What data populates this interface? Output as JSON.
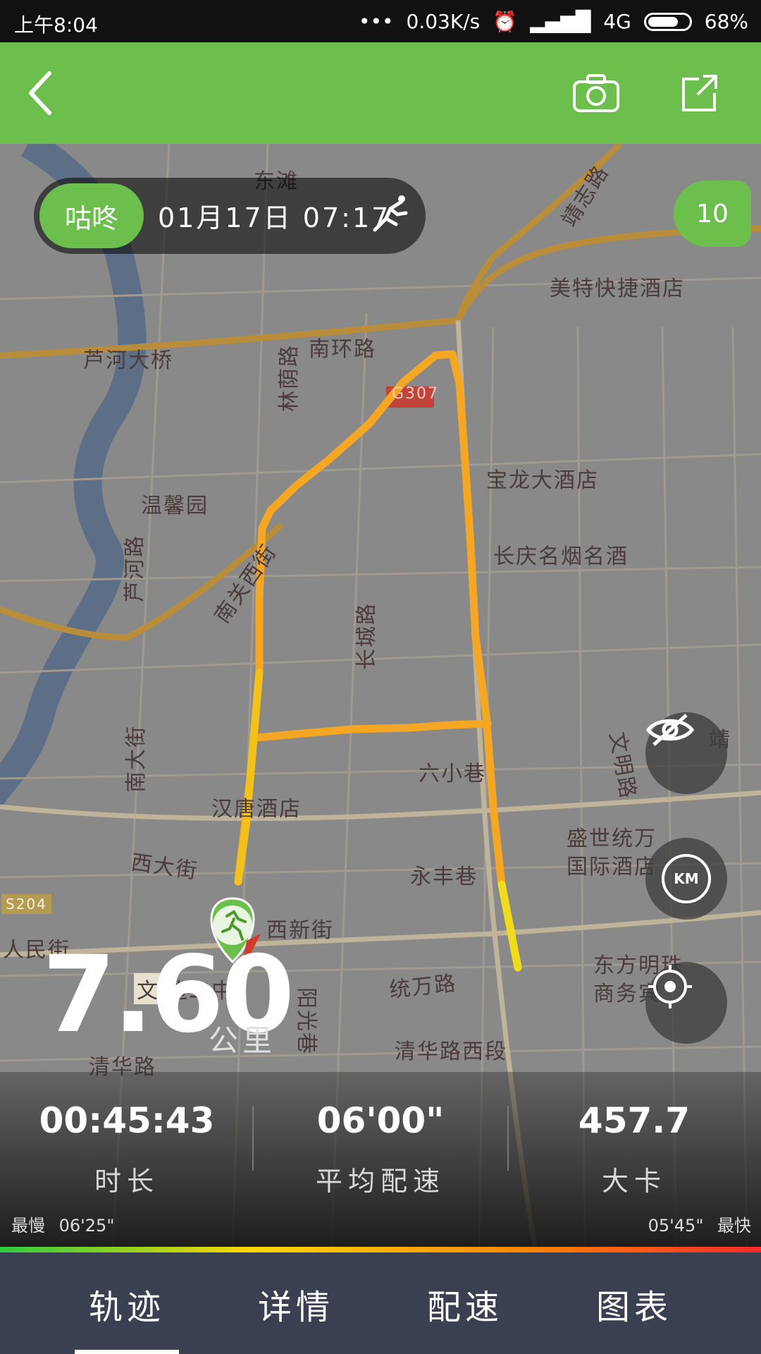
{
  "status_bar": {
    "time": "上午8:04",
    "net_speed": "0.03K/s",
    "signal": "4G",
    "battery": "68%"
  },
  "map": {
    "labels": {
      "l1": "东滩",
      "l2": "靖志路",
      "l3": "美特快捷酒店",
      "l4": "芦河大桥",
      "l5": "南环路",
      "l6": "G307",
      "l7": "林荫路",
      "l8": "宝龙大酒店",
      "l9": "温馨园",
      "l10": "长庆名烟名酒",
      "l11": "芦河路",
      "l12": "南关西街",
      "l13": "长城路",
      "l14": "南大街",
      "l15": "六小巷",
      "l16": "汉唐酒店",
      "l17": "文明路",
      "l18": "盛世统万",
      "l19": "国际酒店",
      "l20": "西大街",
      "l21": "永丰巷",
      "l22": "西新街",
      "l23": "S204",
      "l24": "人民街",
      "l25": "东方明珠",
      "l26": "商务宾",
      "l27": "统万路",
      "l28": "边二中",
      "l29": "阳光巷",
      "l30": "清华路西段",
      "l31": "清华路",
      "l32": "文",
      "l33": "靖"
    }
  },
  "session": {
    "brand": "咕咚",
    "datetime": "01月17日 07:17",
    "badge": "10"
  },
  "distance": {
    "value": "7.60",
    "unit": "公里"
  },
  "stats": [
    {
      "value": "00:45:43",
      "label": "时长"
    },
    {
      "value": "06'00\"",
      "label": "平均配速"
    },
    {
      "value": "457.7",
      "label": "大卡"
    }
  ],
  "pace_range": {
    "slowest_label": "最慢",
    "slowest_value": "06'25\"",
    "fastest_value": "05'45\"",
    "fastest_label": "最快"
  },
  "tabs": [
    "轨迹",
    "详情",
    "配速",
    "图表"
  ],
  "fab_labels": {
    "km": "KM"
  },
  "colors": {
    "accent": "#6cbf4c",
    "route": "#f5a623",
    "tabbar": "#3a3f52"
  }
}
